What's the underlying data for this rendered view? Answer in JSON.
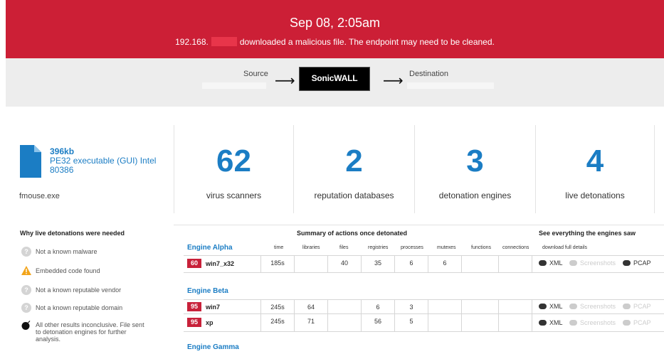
{
  "banner": {
    "time": "Sep 08, 2:05am",
    "ip_prefix": "192.168.",
    "message": "downloaded a malicious file. The endpoint may need to be cleaned."
  },
  "flow": {
    "source_label": "Source",
    "device": "SonicWALL",
    "destination_label": "Destination"
  },
  "file": {
    "size": "396kb",
    "type": "PE32 executable (GUI) Intel 80386",
    "name": "fmouse.exe"
  },
  "stats": [
    {
      "value": "62",
      "label": "virus scanners"
    },
    {
      "value": "2",
      "label": "reputation databases"
    },
    {
      "value": "3",
      "label": "detonation engines"
    },
    {
      "value": "4",
      "label": "live detonations"
    }
  ],
  "why": {
    "title": "Why live detonations were needed",
    "items": [
      "Not a known malware",
      "Embedded code found",
      "Not a known reputable vendor",
      "Not a known reputable domain",
      "All other results inconclusive. File sent to detonation engines for further analysis."
    ]
  },
  "table": {
    "summary_title": "Summary of actions once detonated",
    "see_title": "See everything the engines saw",
    "columns": [
      "time",
      "libraries",
      "files",
      "registries",
      "processes",
      "mutexes",
      "functions",
      "connections"
    ],
    "download_header": "download full details",
    "engines": [
      {
        "name": "Engine Alpha",
        "rows": [
          {
            "score": "60",
            "os": "win7_x32",
            "cells": [
              "185s",
              "",
              "40",
              "35",
              "6",
              "6",
              "",
              ""
            ]
          }
        ]
      },
      {
        "name": "Engine Beta",
        "rows": [
          {
            "score": "95",
            "os": "win7",
            "cells": [
              "245s",
              "64",
              "",
              "6",
              "3",
              "",
              "",
              ""
            ]
          },
          {
            "score": "95",
            "os": "xp",
            "cells": [
              "245s",
              "71",
              "",
              "56",
              "5",
              "",
              "",
              ""
            ]
          }
        ]
      },
      {
        "name": "Engine Gamma",
        "rows": []
      }
    ],
    "downloads": [
      "XML",
      "Screenshots",
      "PCAP"
    ]
  },
  "colors": {
    "banner": "#cc1f36",
    "accent": "#1b7dc4",
    "score": "#c8213a"
  }
}
